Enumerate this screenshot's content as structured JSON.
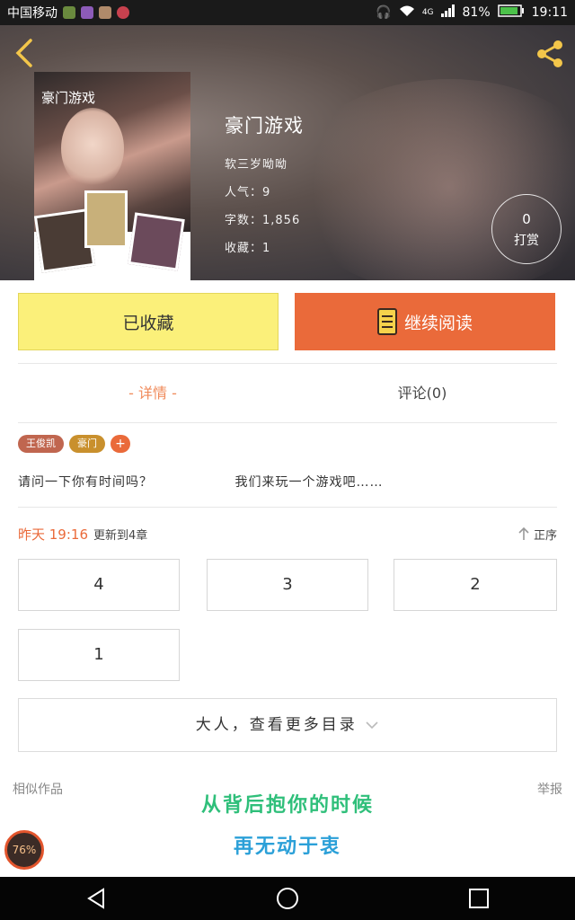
{
  "status_bar": {
    "carrier": "中国移动",
    "network": "4G",
    "battery": "81%",
    "time": "19:11"
  },
  "book": {
    "cover_title": "豪门游戏",
    "title": "豪门游戏",
    "author": "软三岁呦呦",
    "popularity": "人气：9",
    "word_count": "字数：1,856",
    "favorites": "收藏：1"
  },
  "tip": {
    "count": "0",
    "label": "打赏"
  },
  "actions": {
    "collected_label": "已收藏",
    "continue_label": "继续阅读"
  },
  "tabs": {
    "details": "- 详情 -",
    "comments": "评论(0)"
  },
  "tags": [
    {
      "label": "王俊凯",
      "color": "#c0664f"
    },
    {
      "label": "豪门",
      "color": "#c9902d"
    },
    {
      "label": "+",
      "color": "#ea6a3a"
    }
  ],
  "description": {
    "part1": "请问一下你有时间吗？",
    "part2": "我们来玩一个游戏吧……"
  },
  "update": {
    "time": "昨天 19:16",
    "text": "更新到4章",
    "sort_label": "正序"
  },
  "chapters": [
    "4",
    "3",
    "2",
    "1"
  ],
  "more_label": "大人，查看更多目录",
  "similar_label": "相似作品",
  "report_label": "举报",
  "lyrics": {
    "line1": "从背后抱你的时候",
    "line2": "再无动于衷"
  },
  "memory_badge": "76%"
}
